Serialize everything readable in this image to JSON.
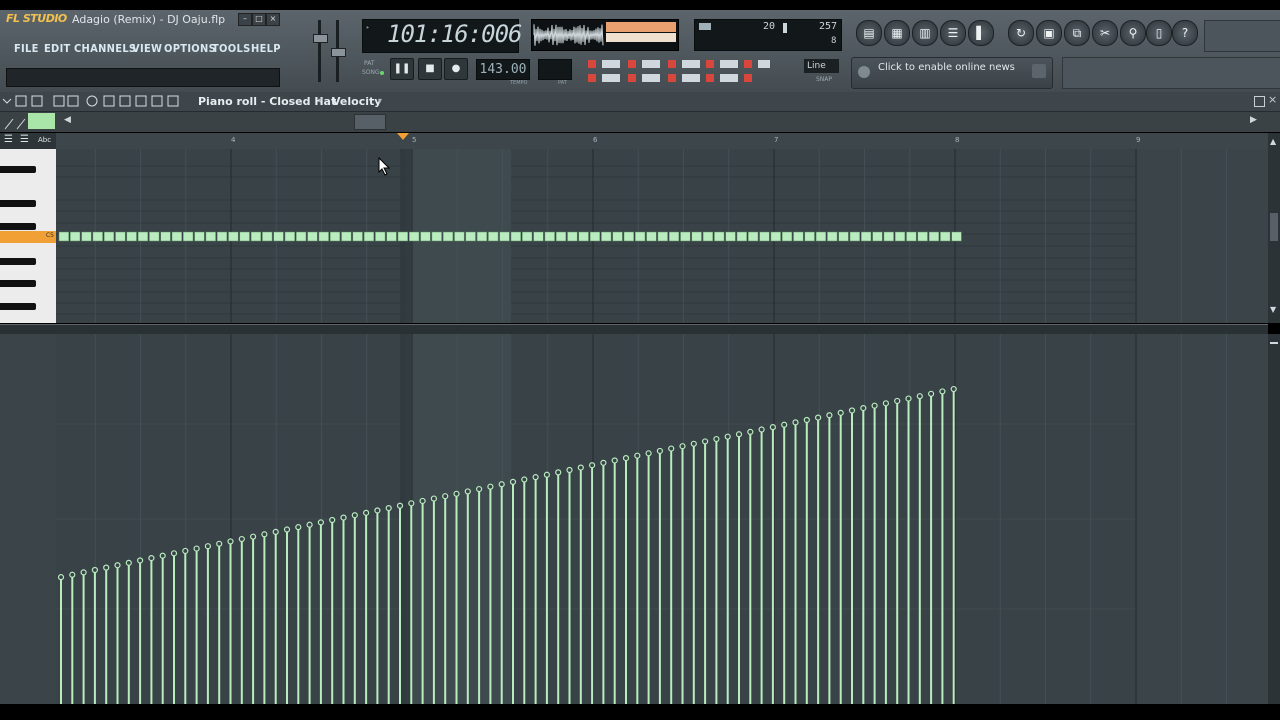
{
  "app": {
    "logo_text": "FL STUDIO",
    "song_title": "Adagio (Remix) - DJ Oaju.flp"
  },
  "menu": [
    "FILE",
    "EDIT",
    "CHANNELS",
    "VIEW",
    "OPTIONS",
    "TOOLS",
    "HELP"
  ],
  "transport": {
    "time": "101:16:006",
    "pat_label": "PAT",
    "song_label": "SONG",
    "tempo": "143.00",
    "tempo_label": "TEMPO",
    "pat_caption": "PAT"
  },
  "cpu": {
    "left_value": "20",
    "right_value": "257",
    "poly_value": "8"
  },
  "snap": {
    "mode": "Line",
    "caption": "SNAP"
  },
  "news": {
    "text": "Click to enable online news"
  },
  "piano_roll": {
    "title": "Piano roll - Closed Hat",
    "target": "Velocity",
    "bar_numbers": [
      "4",
      "5",
      "6",
      "7",
      "8",
      "9"
    ],
    "note_key_label": "C5",
    "playhead_bar": 5
  },
  "velocity": {
    "note_count": 80,
    "start_level": 0.34,
    "end_level": 0.93
  },
  "colors": {
    "accent": "#f2c14e",
    "note_green": "#b9ecbf",
    "background": "#384247",
    "playhead": "#f0a035"
  }
}
